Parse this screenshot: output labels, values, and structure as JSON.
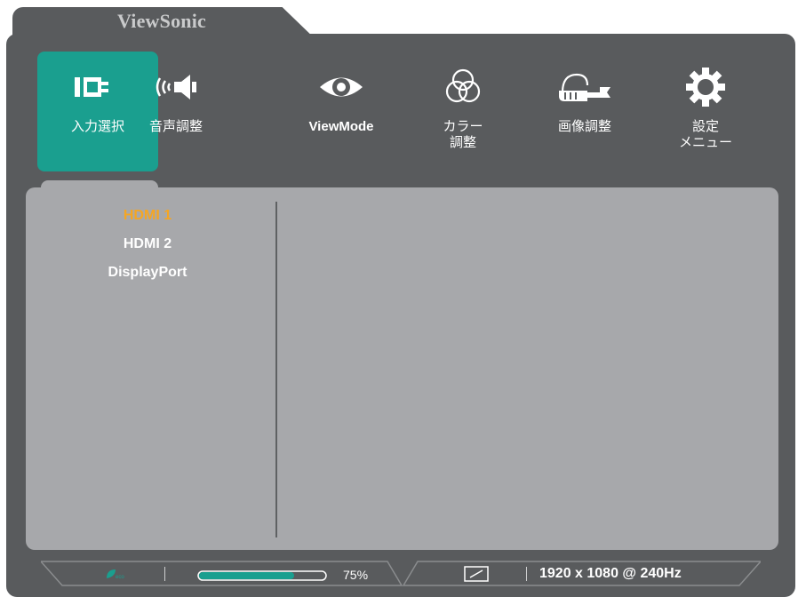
{
  "brand": {
    "name": "ViewSonic"
  },
  "tabs": [
    {
      "id": "input-select",
      "label": "入力選択",
      "icon": "input-plug-icon",
      "active": true
    },
    {
      "id": "audio-adjust",
      "label": "音声調整",
      "icon": "speaker-icon",
      "active": false
    },
    {
      "id": "viewmode",
      "label": "ViewMode",
      "icon": "eye-icon",
      "active": false
    },
    {
      "id": "color-adjust",
      "label": "カラー\n調整",
      "icon": "color-circles-icon",
      "active": false
    },
    {
      "id": "image-adjust",
      "label": "画像調整",
      "icon": "wrench-hand-icon",
      "active": false
    },
    {
      "id": "setup-menu",
      "label": "設定\nメニュー",
      "icon": "gear-icon",
      "active": false
    }
  ],
  "inputs": {
    "items": [
      "HDMI 1",
      "HDMI 2",
      "DisplayPort"
    ],
    "selected": "HDMI 1"
  },
  "status": {
    "brightness_percent": 75,
    "brightness_label": "75%",
    "resolution": "1920 x 1080 @ 240Hz"
  },
  "colors": {
    "accent": "#1a9f8f",
    "selected_text": "#f5a623",
    "osd_background": "#595b5d",
    "panel_background": "#a7a8ab"
  }
}
